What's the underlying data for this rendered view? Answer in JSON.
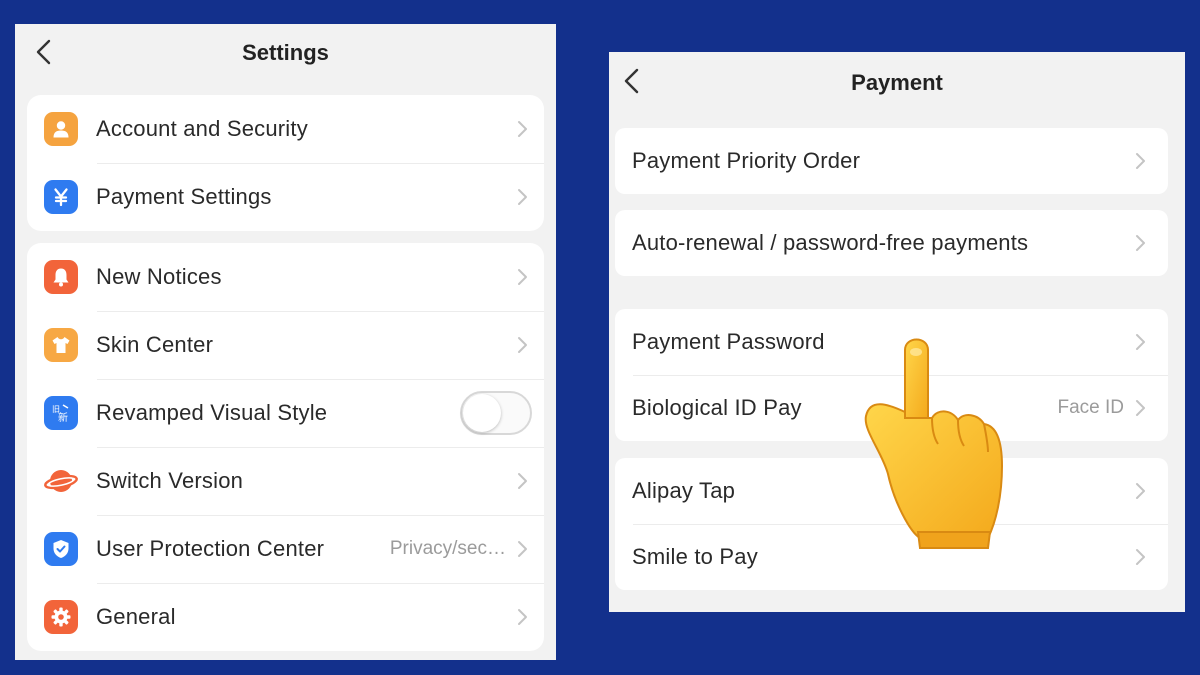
{
  "settings": {
    "title": "Settings",
    "groups": [
      {
        "items": [
          {
            "label": "Account and Security",
            "icon": "person-icon",
            "color": "#f5a33f"
          },
          {
            "label": "Payment Settings",
            "icon": "yuan-icon",
            "color": "#2f7bf0"
          }
        ]
      },
      {
        "items": [
          {
            "label": "New Notices",
            "icon": "bell-icon",
            "color": "#f2643a"
          },
          {
            "label": "Skin Center",
            "icon": "shirt-icon",
            "color": "#f7a844"
          },
          {
            "label": "Revamped Visual Style",
            "icon": "old-new-icon",
            "color": "#2f7bf0",
            "control": "toggle",
            "toggle_on": false
          },
          {
            "label": "Switch Version",
            "icon": "planet-icon",
            "color": "#f2643a"
          },
          {
            "label": "User Protection Center",
            "icon": "shield-icon",
            "color": "#2f7bf0",
            "value": "Privacy/sec…"
          },
          {
            "label": "General",
            "icon": "gear-icon",
            "color": "#f2643a"
          }
        ]
      }
    ]
  },
  "payment": {
    "title": "Payment",
    "groups": [
      {
        "items": [
          {
            "label": "Payment Priority Order"
          }
        ]
      },
      {
        "items": [
          {
            "label": "Auto-renewal / password-free payments"
          }
        ]
      },
      {
        "items": [
          {
            "label": "Payment Password"
          },
          {
            "label": "Biological ID Pay",
            "value": "Face ID"
          }
        ]
      },
      {
        "items": [
          {
            "label": "Alipay Tap"
          },
          {
            "label": "Smile to Pay"
          }
        ]
      }
    ]
  },
  "overlay": {
    "icon": "pointing-hand-icon"
  },
  "colors": {
    "background": "#13308c",
    "panel": "#f2f2f2",
    "card": "#ffffff"
  }
}
